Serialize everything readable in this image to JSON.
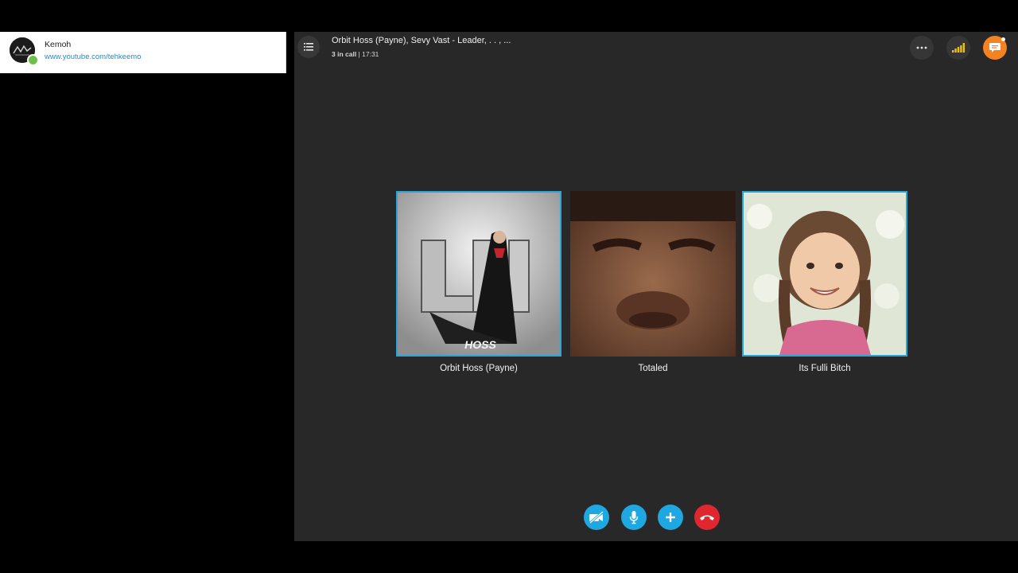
{
  "profile": {
    "name": "Kemoh",
    "link": "www.youtube.com/tehkeemo",
    "presence": "online"
  },
  "call": {
    "title": "Orbit Hoss (Payne), Sevy Vast - Leader, . . , ...",
    "in_call": "3 in call",
    "duration": "17:31"
  },
  "participants": [
    {
      "name": "Orbit Hoss (Payne)",
      "speaking": true,
      "avatar_text": "HOSS"
    },
    {
      "name": "Totaled",
      "speaking": false
    },
    {
      "name": "Its Fulli Bitch",
      "speaking": true
    }
  ],
  "controls": {
    "video": "video-off-icon",
    "mic": "microphone-icon",
    "add": "plus-icon",
    "hangup": "hang-up-icon"
  },
  "header_icons": [
    "list-icon",
    "more-icon",
    "signal-icon",
    "chat-icon"
  ],
  "colors": {
    "accent": "#1ea7e1",
    "hangup": "#e0262f",
    "chat": "#f58220",
    "presence": "#6cc04a",
    "speaking_border": "#29a6d8",
    "panel_bg": "#282828"
  }
}
